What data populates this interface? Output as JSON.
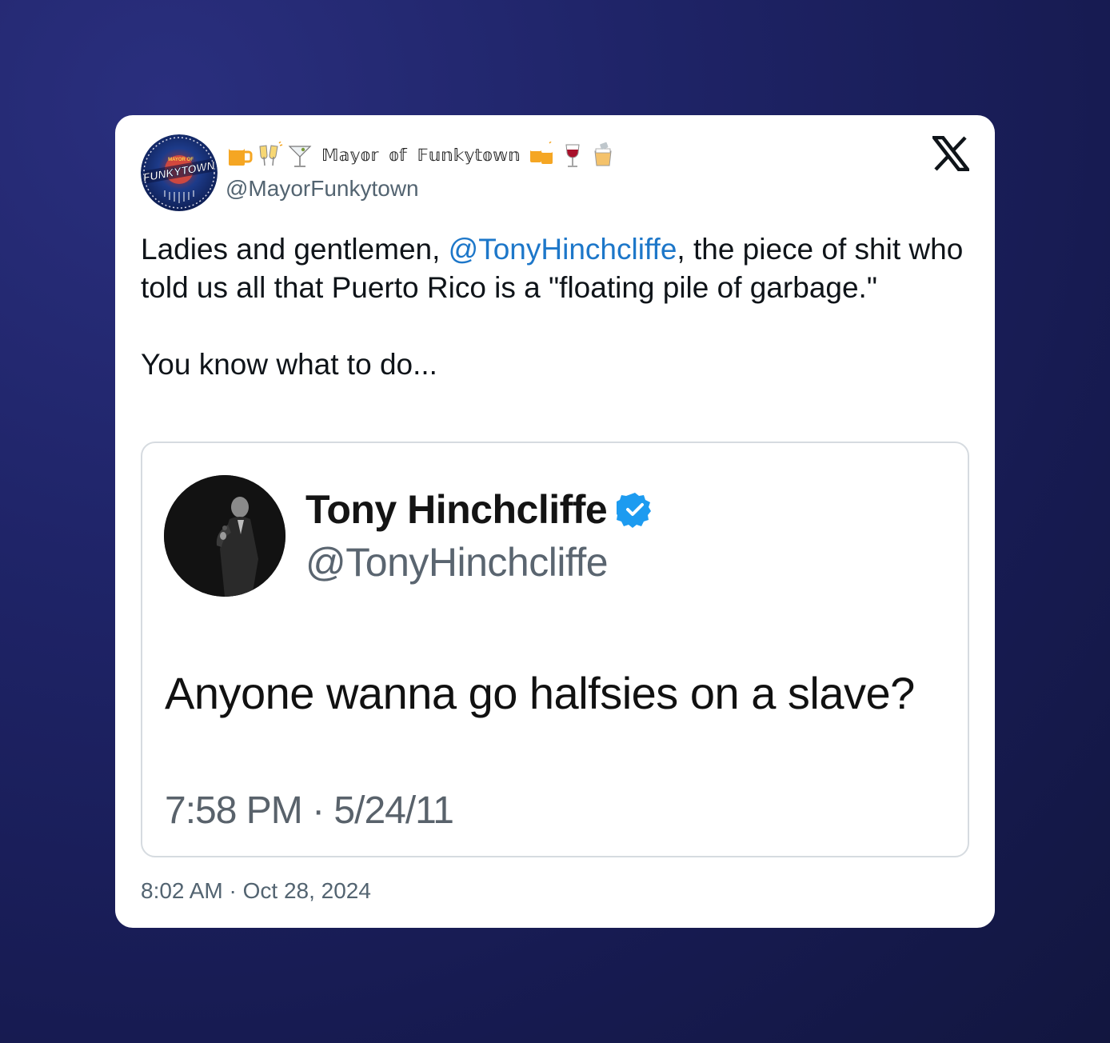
{
  "tweet": {
    "display_name_glyphs": "𝕄𝕒𝕪𝕠𝕣 𝕠𝕗 𝔽𝕦𝕟𝕜𝕪𝕥𝕠𝕨𝕟",
    "display_name_emojis_before": [
      "beer-mug-emoji",
      "clinking-glasses-emoji",
      "cocktail-emoji"
    ],
    "display_name_emojis_after": [
      "clinking-beer-mugs-emoji",
      "wine-glass-emoji",
      "tumbler-emoji"
    ],
    "handle": "@MayorFunkytown",
    "avatar_label_top": "MAYOR OF",
    "avatar_label_main": "FUNKYTOWN",
    "text_part1": "Ladies and gentlemen, ",
    "mention": "@TonyHinchcliffe",
    "text_part2": ", the piece of shit who told us all that Puerto Rico is a \"floating pile of garbage.\"\n\nYou know what to do...",
    "timestamp": "8:02 AM · Oct 28, 2024",
    "platform_icon": "x-logo-icon"
  },
  "quoted": {
    "name": "Tony Hinchcliffe",
    "handle": "@TonyHinchcliffe",
    "text": "Anyone wanna go halfsies on a slave?",
    "time": "7:58 PM · 5/24/11",
    "verified_icon": "verified-badge-icon"
  },
  "colors": {
    "background": "#1f2468",
    "mention": "#1d77c9",
    "secondary_text": "#536471",
    "verified": "#1d9bf0"
  }
}
